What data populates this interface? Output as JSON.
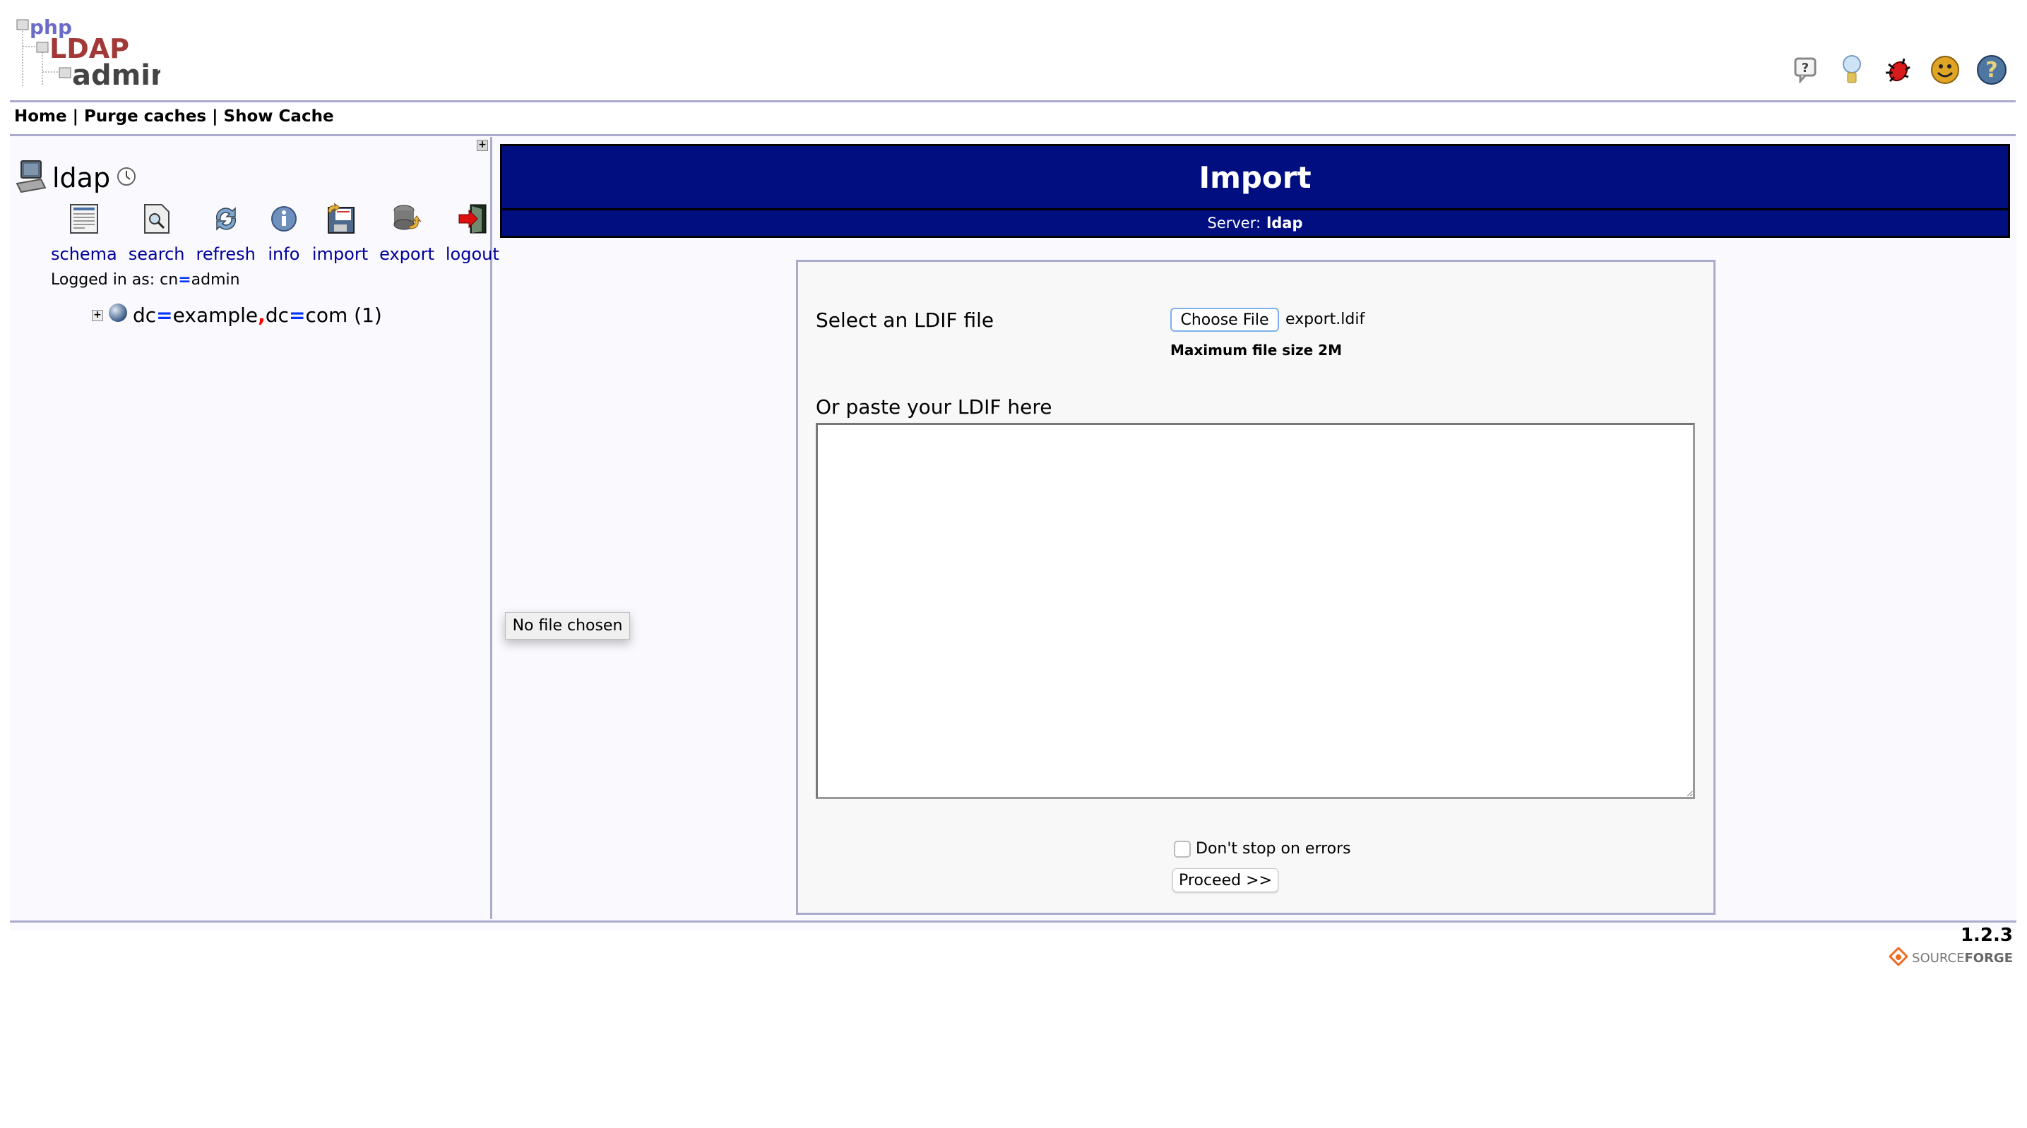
{
  "app": {
    "logo_text": [
      "php",
      "LDAP",
      "admin"
    ]
  },
  "header_icons": [
    {
      "name": "help-bubble-icon",
      "glyph": "?"
    },
    {
      "name": "lightbulb-icon",
      "glyph": "💡"
    },
    {
      "name": "bug-icon",
      "glyph": "🐞"
    },
    {
      "name": "smiley-icon",
      "glyph": "☺"
    },
    {
      "name": "help-icon",
      "glyph": "?"
    }
  ],
  "nav": {
    "home": "Home",
    "purge": "Purge caches",
    "show_cache": "Show Cache",
    "sep": "|"
  },
  "sidebar": {
    "toggle": "+",
    "server_name": "ldap",
    "tools": [
      {
        "label": "schema",
        "icon": "schema-icon"
      },
      {
        "label": "search",
        "icon": "search-icon"
      },
      {
        "label": "refresh",
        "icon": "refresh-icon"
      },
      {
        "label": "info",
        "icon": "info-icon"
      },
      {
        "label": "import",
        "icon": "import-icon"
      },
      {
        "label": "export",
        "icon": "export-icon"
      },
      {
        "label": "logout",
        "icon": "logout-icon"
      }
    ],
    "logged_in_prefix": "Logged in as: ",
    "logged_in_attr": "cn",
    "logged_in_value": "admin",
    "tree": {
      "rdn1_attr": "dc",
      "rdn1_val": "example",
      "rdn2_attr": "dc",
      "rdn2_val": "com",
      "count": " (1)"
    },
    "eq": "=",
    "comma": ","
  },
  "banner": {
    "title": "Import",
    "server_label": "Server:",
    "server_value": "ldap"
  },
  "form": {
    "select_label": "Select an LDIF file",
    "choose_file": "Choose File",
    "file_name": "export.ldif",
    "max_size": "Maximum file size 2M",
    "paste_label": "Or paste your LDIF here",
    "ldif_value": "",
    "dont_stop_label": "Don't stop on errors",
    "dont_stop_checked": false,
    "proceed": "Proceed >>"
  },
  "tooltip": {
    "text": "No file chosen"
  },
  "footer": {
    "version": "1.2.3",
    "sourceforge_light": "SOURCE",
    "sourceforge_bold": "FORGE"
  },
  "colors": {
    "banner": "#000e80",
    "link": "#000099",
    "rule": "#aaaacc",
    "eq": "#0033ff",
    "comma": "#ff0000"
  }
}
